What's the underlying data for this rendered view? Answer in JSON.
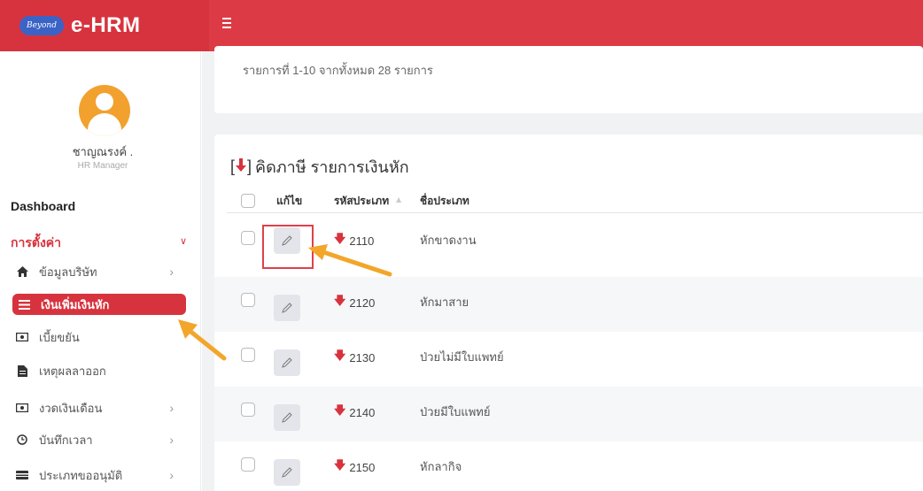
{
  "brand": {
    "badge": "Beyond",
    "name": "e-HRM"
  },
  "user": {
    "name": "ชาญณรงค์ .",
    "role": "HR Manager"
  },
  "nav": {
    "dashboard": "Dashboard",
    "settings": "การตั้งค่า",
    "items": [
      {
        "label": "ข้อมูลบริษัท",
        "icon": "home-icon",
        "has_arrow": true
      },
      {
        "label": "เงินเพิ่มเงินหัก",
        "icon": "list-icon",
        "active": true
      },
      {
        "label": "เบี้ยขยัน",
        "icon": "money-icon"
      },
      {
        "label": "เหตุผลลาออก",
        "icon": "file-icon"
      },
      {
        "label": "งวดเงินเดือน",
        "icon": "money-icon",
        "has_arrow": true
      },
      {
        "label": "บันทึกเวลา",
        "icon": "clock-icon",
        "has_arrow": true
      },
      {
        "label": "ประเภทขออนุมัติ",
        "icon": "card-icon",
        "has_arrow": true
      }
    ]
  },
  "summary": {
    "info": "รายการที่ 1-10 จากทั้งหมด 28 รายการ"
  },
  "table": {
    "title_bracket_open": "[",
    "title_bracket_close": "]",
    "title": "คิดภาษี รายการเงินหัก",
    "columns": {
      "edit": "แก้ไข",
      "code": "รหัสประเภท",
      "name": "ชื่อประเภท"
    },
    "rows": [
      {
        "code": "2110",
        "name": "หักขาดงาน"
      },
      {
        "code": "2120",
        "name": "หักมาสาย"
      },
      {
        "code": "2130",
        "name": "ป่วยไม่มีใบแพทย์"
      },
      {
        "code": "2140",
        "name": "ป่วยมีใบแพทย์"
      },
      {
        "code": "2150",
        "name": "หักลากิจ"
      }
    ]
  },
  "colors": {
    "primary": "#dc3b45",
    "sidebar_active": "#d7333e",
    "avatar": "#f2a12e",
    "callout": "#f2a62a",
    "bg": "#f1f2f4"
  }
}
